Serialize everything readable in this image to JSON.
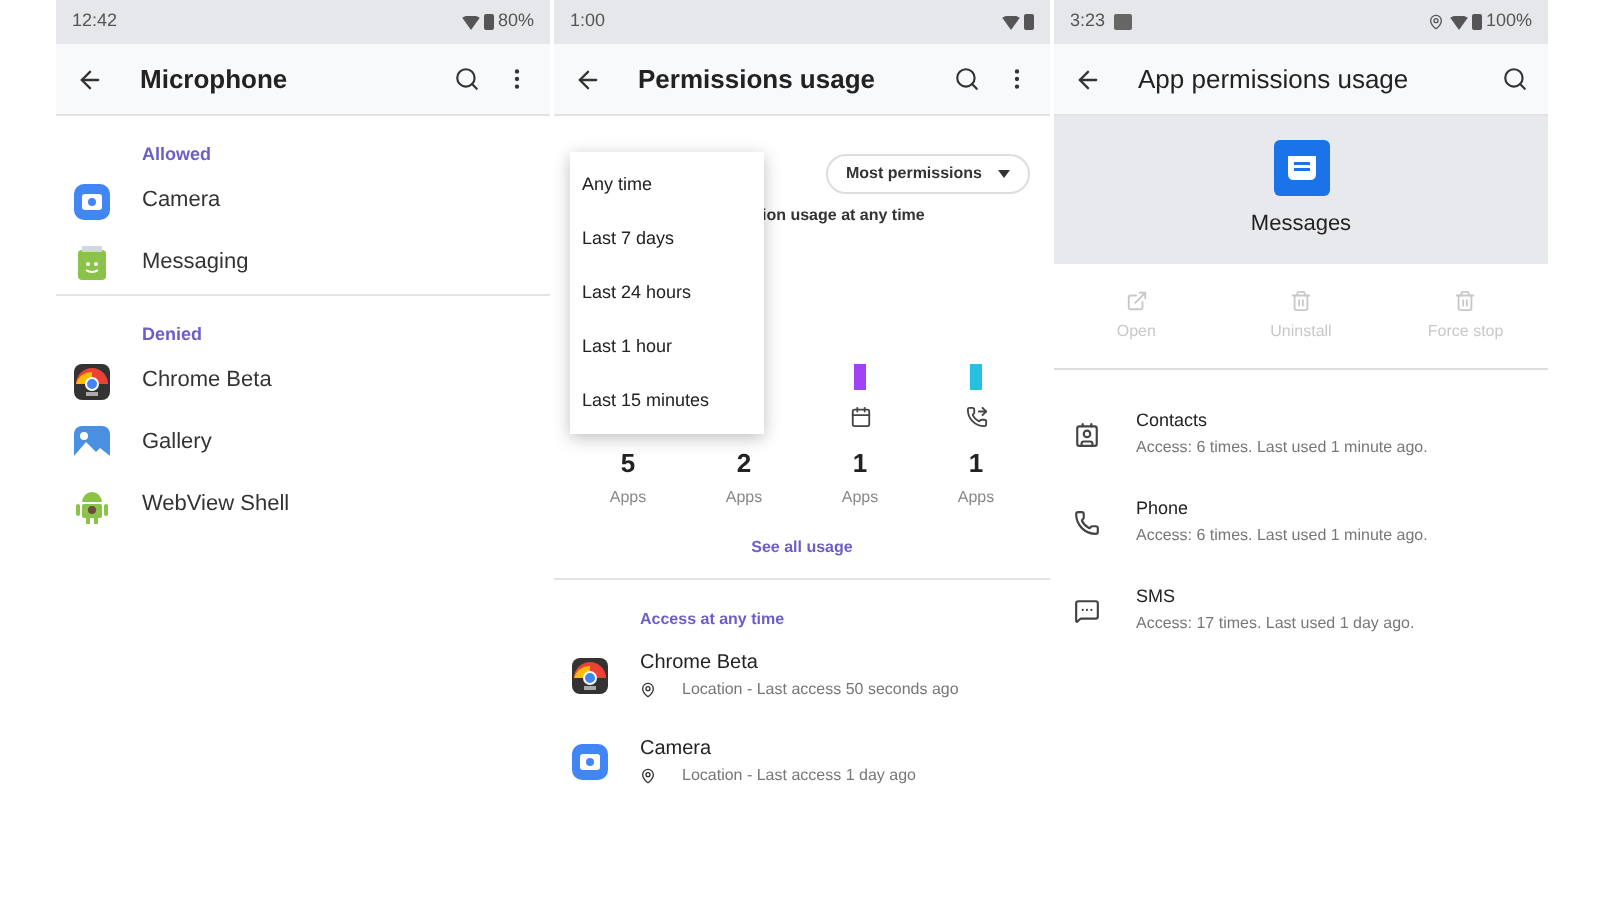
{
  "microphone_screen": {
    "status_bar": {
      "time": "12:42",
      "battery": "80%"
    },
    "title": "Microphone",
    "sections": [
      {
        "header": "Allowed",
        "apps": [
          {
            "name": "Camera",
            "kind": "camera"
          },
          {
            "name": "Messaging",
            "kind": "messaging"
          }
        ]
      },
      {
        "header": "Denied",
        "apps": [
          {
            "name": "Chrome Beta",
            "kind": "chrome"
          },
          {
            "name": "Gallery",
            "kind": "gallery"
          },
          {
            "name": "WebView Shell",
            "kind": "android"
          }
        ]
      }
    ]
  },
  "permissions_usage_screen": {
    "status_bar": {
      "time": "1:00"
    },
    "title": "Permissions usage",
    "time_menu": [
      "Any time",
      "Last 7 days",
      "Last 24 hours",
      "Last 1 hour",
      "Last 15 minutes"
    ],
    "sort_chip": "Most permissions",
    "subtitle": "ion usage at any time",
    "columns": [
      {
        "count": "5",
        "unit": "Apps"
      },
      {
        "count": "2",
        "unit": "Apps"
      },
      {
        "count": "1",
        "unit": "Apps",
        "kind": "calendar",
        "color": "#a142f4"
      },
      {
        "count": "1",
        "unit": "Apps",
        "kind": "call_log",
        "color": "#24c1e0"
      }
    ],
    "see_all": "See all usage",
    "section_header": "Access at any time",
    "apps": [
      {
        "name": "Chrome Beta",
        "kind": "chrome",
        "detail": "Location - Last access 50 seconds ago"
      },
      {
        "name": "Camera",
        "kind": "camera",
        "detail": "Location - Last access 1 day ago"
      }
    ]
  },
  "app_permissions_screen": {
    "status_bar": {
      "time": "3:23",
      "battery": "100%"
    },
    "title": "App permissions usage",
    "app_name": "Messages",
    "actions": [
      {
        "label": "Open",
        "kind": "open",
        "disabled": true
      },
      {
        "label": "Uninstall",
        "kind": "trash",
        "disabled": true
      },
      {
        "label": "Force stop",
        "kind": "trash",
        "disabled": true
      }
    ],
    "permissions": [
      {
        "name": "Contacts",
        "kind": "contacts",
        "detail": "Access: 6 times. Last used 1 minute ago."
      },
      {
        "name": "Phone",
        "kind": "phone",
        "detail": "Access: 6 times. Last used 1 minute ago."
      },
      {
        "name": "SMS",
        "kind": "sms",
        "detail": "Access: 17 times. Last used 1 day ago."
      }
    ]
  }
}
